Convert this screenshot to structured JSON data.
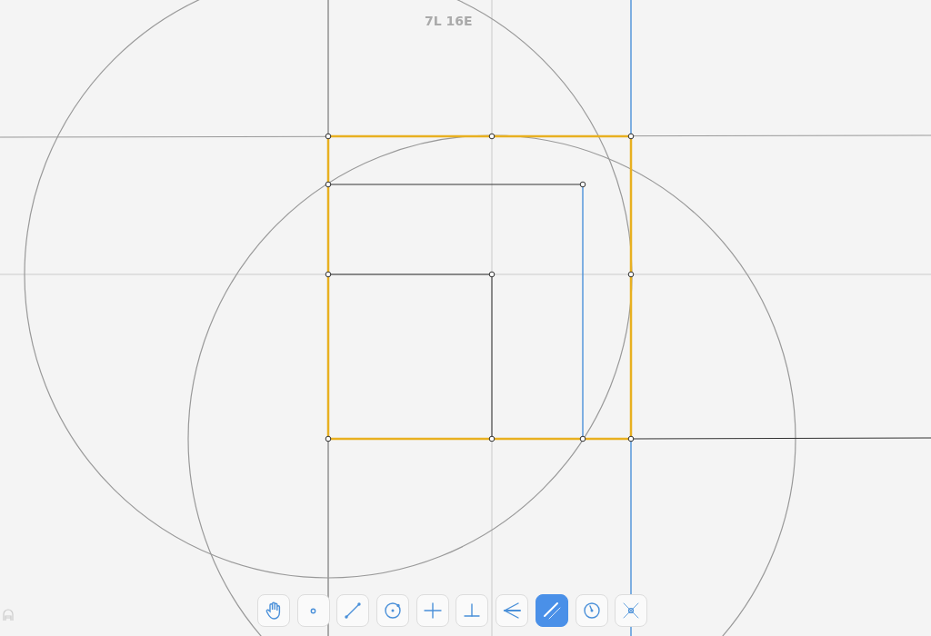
{
  "score": "7L 16E",
  "tools": [
    {
      "kind": "hand",
      "selected": false
    },
    {
      "kind": "point",
      "selected": false
    },
    {
      "kind": "line",
      "selected": false
    },
    {
      "kind": "circle",
      "selected": false
    },
    {
      "kind": "bisector",
      "selected": false
    },
    {
      "kind": "perpendicular",
      "selected": false
    },
    {
      "kind": "angle-bisector",
      "selected": false
    },
    {
      "kind": "parallel",
      "selected": true
    },
    {
      "kind": "compass",
      "selected": false
    },
    {
      "kind": "intersect",
      "selected": false
    }
  ]
}
